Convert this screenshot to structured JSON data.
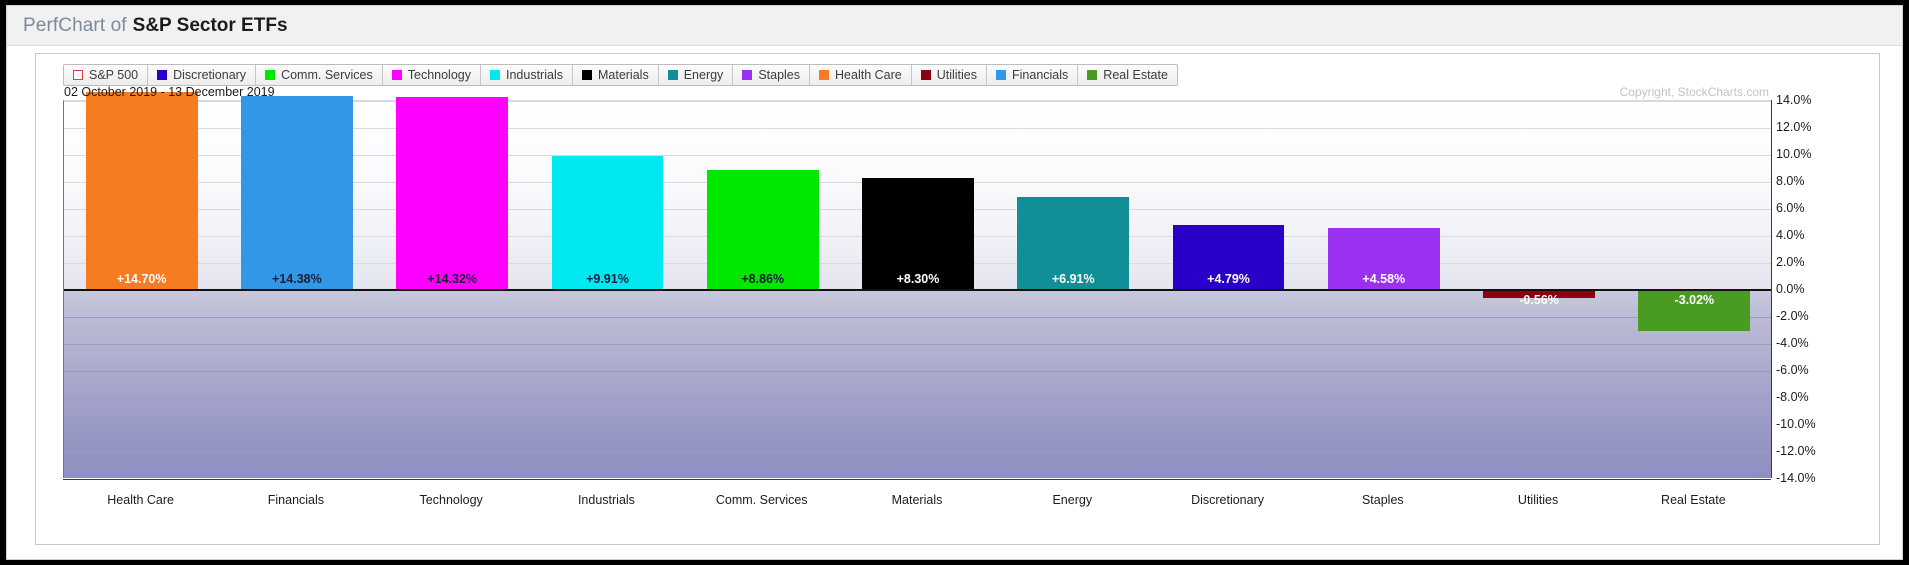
{
  "header": {
    "title_prefix": "PerfChart of",
    "title_main": "S&P Sector ETFs"
  },
  "legend": {
    "items": [
      {
        "label": "S&P 500",
        "color": "#e8383d",
        "style": "hollow"
      },
      {
        "label": "Discretionary",
        "color": "#2800c8",
        "style": "solid"
      },
      {
        "label": "Comm. Services",
        "color": "#00e800",
        "style": "solid"
      },
      {
        "label": "Technology",
        "color": "#ff00ff",
        "style": "solid"
      },
      {
        "label": "Industrials",
        "color": "#00e8f0",
        "style": "solid"
      },
      {
        "label": "Materials",
        "color": "#000000",
        "style": "solid"
      },
      {
        "label": "Energy",
        "color": "#128f96",
        "style": "solid"
      },
      {
        "label": "Staples",
        "color": "#9b30f0",
        "style": "solid"
      },
      {
        "label": "Health Care",
        "color": "#f77b20",
        "style": "solid"
      },
      {
        "label": "Utilities",
        "color": "#8b0010",
        "style": "solid"
      },
      {
        "label": "Financials",
        "color": "#3397e8",
        "style": "solid"
      },
      {
        "label": "Real Estate",
        "color": "#4a9b22",
        "style": "solid"
      }
    ]
  },
  "plot": {
    "date_range": "02 October 2019 - 13 December 2019",
    "copyright": "Copyright, StockCharts.com"
  },
  "chart_data": {
    "type": "bar",
    "title": "PerfChart of S&P Sector ETFs",
    "subtitle": "02 October 2019 - 13 December 2019",
    "xlabel": "",
    "ylabel": "",
    "ylim": [
      -14.0,
      14.0
    ],
    "grid": true,
    "legend_position": "top",
    "ytick_labels": [
      "14.0%",
      "12.0%",
      "10.0%",
      "8.0%",
      "6.0%",
      "4.0%",
      "2.0%",
      "0.0%",
      "-2.0%",
      "-4.0%",
      "-6.0%",
      "-8.0%",
      "-10.0%",
      "-12.0%",
      "-14.0%"
    ],
    "ytick_values": [
      14,
      12,
      10,
      8,
      6,
      4,
      2,
      0,
      -2,
      -4,
      -6,
      -8,
      -10,
      -12,
      -14
    ],
    "categories": [
      "Health Care",
      "Financials",
      "Technology",
      "Industrials",
      "Comm. Services",
      "Materials",
      "Energy",
      "Discretionary",
      "Staples",
      "Utilities",
      "Real Estate"
    ],
    "values": [
      14.7,
      14.38,
      14.32,
      9.91,
      8.86,
      8.3,
      6.91,
      4.79,
      4.58,
      -0.56,
      -3.02
    ],
    "value_labels": [
      "+14.70%",
      "+14.38%",
      "+14.32%",
      "+9.91%",
      "+8.86%",
      "+8.30%",
      "+6.91%",
      "+4.79%",
      "+4.58%",
      "-0.56%",
      "-3.02%"
    ],
    "bar_colors": [
      "#f77b20",
      "#3397e8",
      "#ff00ff",
      "#00e8f0",
      "#00e800",
      "#000000",
      "#128f96",
      "#2800c8",
      "#9b30f0",
      "#8b0010",
      "#4a9b22"
    ],
    "label_text_colors": [
      "#ffffff",
      "#1d1d35",
      "#1d1d35",
      "#1d1d35",
      "#1d1d35",
      "#ffffff",
      "#ffffff",
      "#ffffff",
      "#ffffff",
      "#ffffff",
      "#ffffff"
    ]
  }
}
